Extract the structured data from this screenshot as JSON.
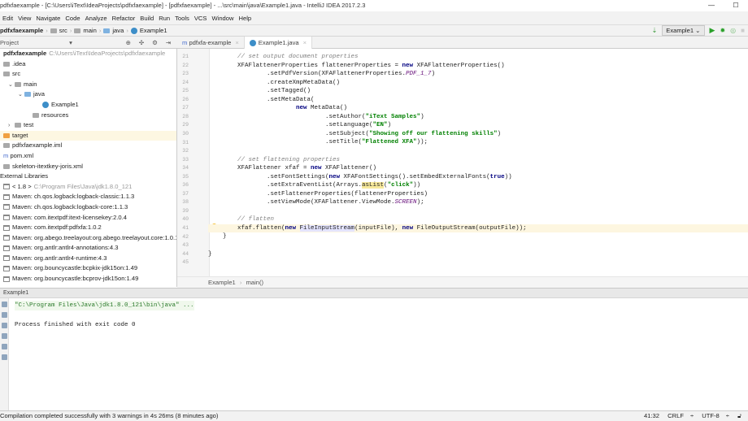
{
  "window": {
    "title": "pdfxfaexample - [C:\\Users\\iText\\IdeaProjects\\pdfxfaexample] - [pdfxfaexample] - ...\\src\\main\\java\\Example1.java - IntelliJ IDEA 2017.2.3"
  },
  "menu": [
    "Edit",
    "View",
    "Navigate",
    "Code",
    "Analyze",
    "Refactor",
    "Build",
    "Run",
    "Tools",
    "VCS",
    "Window",
    "Help"
  ],
  "breadcrumb": [
    "pdfxfaexample",
    "src",
    "main",
    "java",
    "Example1"
  ],
  "run_config": "Example1",
  "project_panel": {
    "label": "Project"
  },
  "tabs": [
    {
      "label": "pdfxfa-example",
      "active": false
    },
    {
      "label": "Example1.java",
      "active": true
    }
  ],
  "tree": [
    {
      "label": "pdfxfaexample",
      "path": "C:\\Users\\iText\\IdeaProjects\\pdfxfaexample",
      "bold": true,
      "depth": 0,
      "icon": "none"
    },
    {
      "label": ".idea",
      "depth": 0,
      "icon": "folder"
    },
    {
      "label": "src",
      "depth": 0,
      "icon": "folder"
    },
    {
      "label": "main",
      "depth": 1,
      "icon": "folder",
      "arrow": "v"
    },
    {
      "label": "java",
      "depth": 2,
      "icon": "folder-blue",
      "arrow": "v"
    },
    {
      "label": "Example1",
      "depth": 4,
      "icon": "class"
    },
    {
      "label": "resources",
      "depth": 3,
      "icon": "folder"
    },
    {
      "label": "test",
      "depth": 1,
      "icon": "folder",
      "arrow": ">"
    },
    {
      "label": "target",
      "depth": 0,
      "icon": "folder-orange",
      "highlight": true
    },
    {
      "label": "pdfxfaexample.iml",
      "depth": 0,
      "icon": "file"
    },
    {
      "label": "pom.xml",
      "depth": 0,
      "icon": "maven"
    },
    {
      "label": "skeleton-itextkey-joris.xml",
      "depth": 0,
      "icon": "file"
    },
    {
      "label": "External Libraries",
      "depth": -1,
      "icon": "none"
    },
    {
      "label": "< 1.8 >",
      "path": "C:\\Program Files\\Java\\jdk1.8.0_121",
      "depth": 0,
      "icon": "library"
    },
    {
      "label": "Maven: ch.qos.logback:logback-classic:1.1.3",
      "depth": 0,
      "icon": "library"
    },
    {
      "label": "Maven: ch.qos.logback:logback-core:1.1.3",
      "depth": 0,
      "icon": "library"
    },
    {
      "label": "Maven: com.itextpdf:itext-licensekey:2.0.4",
      "depth": 0,
      "icon": "library"
    },
    {
      "label": "Maven: com.itextpdf:pdfxfa:1.0.2",
      "depth": 0,
      "icon": "library"
    },
    {
      "label": "Maven: org.abego.treelayout:org.abego.treelayout.core:1.0.1",
      "depth": 0,
      "icon": "library"
    },
    {
      "label": "Maven: org.antlr:antlr4-annotations:4.3",
      "depth": 0,
      "icon": "library"
    },
    {
      "label": "Maven: org.antlr:antlr4-runtime:4.3",
      "depth": 0,
      "icon": "library"
    },
    {
      "label": "Maven: org.bouncycastle:bcpkix-jdk15on:1.49",
      "depth": 0,
      "icon": "library"
    },
    {
      "label": "Maven: org.bouncycastle:bcprov-jdk15on:1.49",
      "depth": 0,
      "icon": "library"
    }
  ],
  "code": {
    "first_line": 21,
    "current_line": 41,
    "lines": [
      [
        [
          "        "
        ],
        [
          "// set output document properties",
          "cm"
        ]
      ],
      [
        [
          "        XFAFlattenerProperties flattenerProperties = "
        ],
        [
          "new",
          "kw"
        ],
        [
          " XFAFlattenerProperties()"
        ]
      ],
      [
        [
          "                .setPdfVersion(XFAFlattenerProperties."
        ],
        [
          "PDF_1_7",
          "const"
        ],
        [
          ")"
        ]
      ],
      [
        [
          "                .createXmpMetaData()"
        ]
      ],
      [
        [
          "                .setTagged()"
        ]
      ],
      [
        [
          "                .setMetaData("
        ]
      ],
      [
        [
          "                        "
        ],
        [
          "new",
          "kw"
        ],
        [
          " MetaData()"
        ]
      ],
      [
        [
          "                                .setAuthor("
        ],
        [
          "\"iText Samples\"",
          "str"
        ],
        [
          ")"
        ]
      ],
      [
        [
          "                                .setLanguage("
        ],
        [
          "\"EN\"",
          "str"
        ],
        [
          ")"
        ]
      ],
      [
        [
          "                                .setSubject("
        ],
        [
          "\"Showing off our flattening skills\"",
          "str"
        ],
        [
          ")"
        ]
      ],
      [
        [
          "                                .setTitle("
        ],
        [
          "\"Flattened XFA\"",
          "str"
        ],
        [
          "));"
        ]
      ],
      [
        [
          ""
        ]
      ],
      [
        [
          "        "
        ],
        [
          "// set flattening properties",
          "cm"
        ]
      ],
      [
        [
          "        XFAFlattener xfaf = "
        ],
        [
          "new",
          "kw"
        ],
        [
          " XFAFlattener()"
        ]
      ],
      [
        [
          "                .setFontSettings("
        ],
        [
          "new",
          "kw"
        ],
        [
          " XFAFontSettings().setEmbedExternalFonts("
        ],
        [
          "true",
          "kw"
        ],
        [
          "))"
        ]
      ],
      [
        [
          "                .setExtraEventList(Arrays."
        ],
        [
          "asList",
          "hl"
        ],
        [
          "("
        ],
        [
          "\"click\"",
          "str"
        ],
        [
          "))"
        ]
      ],
      [
        [
          "                .setFlattenerProperties(flattenerProperties)"
        ]
      ],
      [
        [
          "                .setViewMode(XFAFlattener.ViewMode."
        ],
        [
          "SCREEN",
          "const"
        ],
        [
          ");"
        ]
      ],
      [
        [
          ""
        ]
      ],
      [
        [
          "        "
        ],
        [
          "// flatten",
          "cm"
        ]
      ],
      [
        [
          "        xfaf.flatten("
        ],
        [
          "new",
          "kw"
        ],
        [
          " "
        ],
        [
          "FileInputStream",
          "ref"
        ],
        [
          "(inputFile), "
        ],
        [
          "new",
          "kw"
        ],
        [
          " FileOutputStream(outputFile));"
        ]
      ],
      [
        [
          "    }"
        ]
      ],
      [
        [
          ""
        ]
      ],
      [
        [
          "}"
        ]
      ],
      [
        [
          ""
        ]
      ]
    ]
  },
  "editor_breadcrumb": [
    "Example1",
    "main()"
  ],
  "run_panel": {
    "title": "Example1",
    "lines": [
      "\"C:\\Program Files\\Java\\jdk1.8.0_121\\bin\\java\" ...",
      "",
      "Process finished with exit code 0"
    ]
  },
  "status": {
    "message": "Compilation completed successfully with 3 warnings in 4s 26ms (8 minutes ago)",
    "position": "41:32",
    "line_sep": "CRLF",
    "encoding": "UTF-8"
  }
}
